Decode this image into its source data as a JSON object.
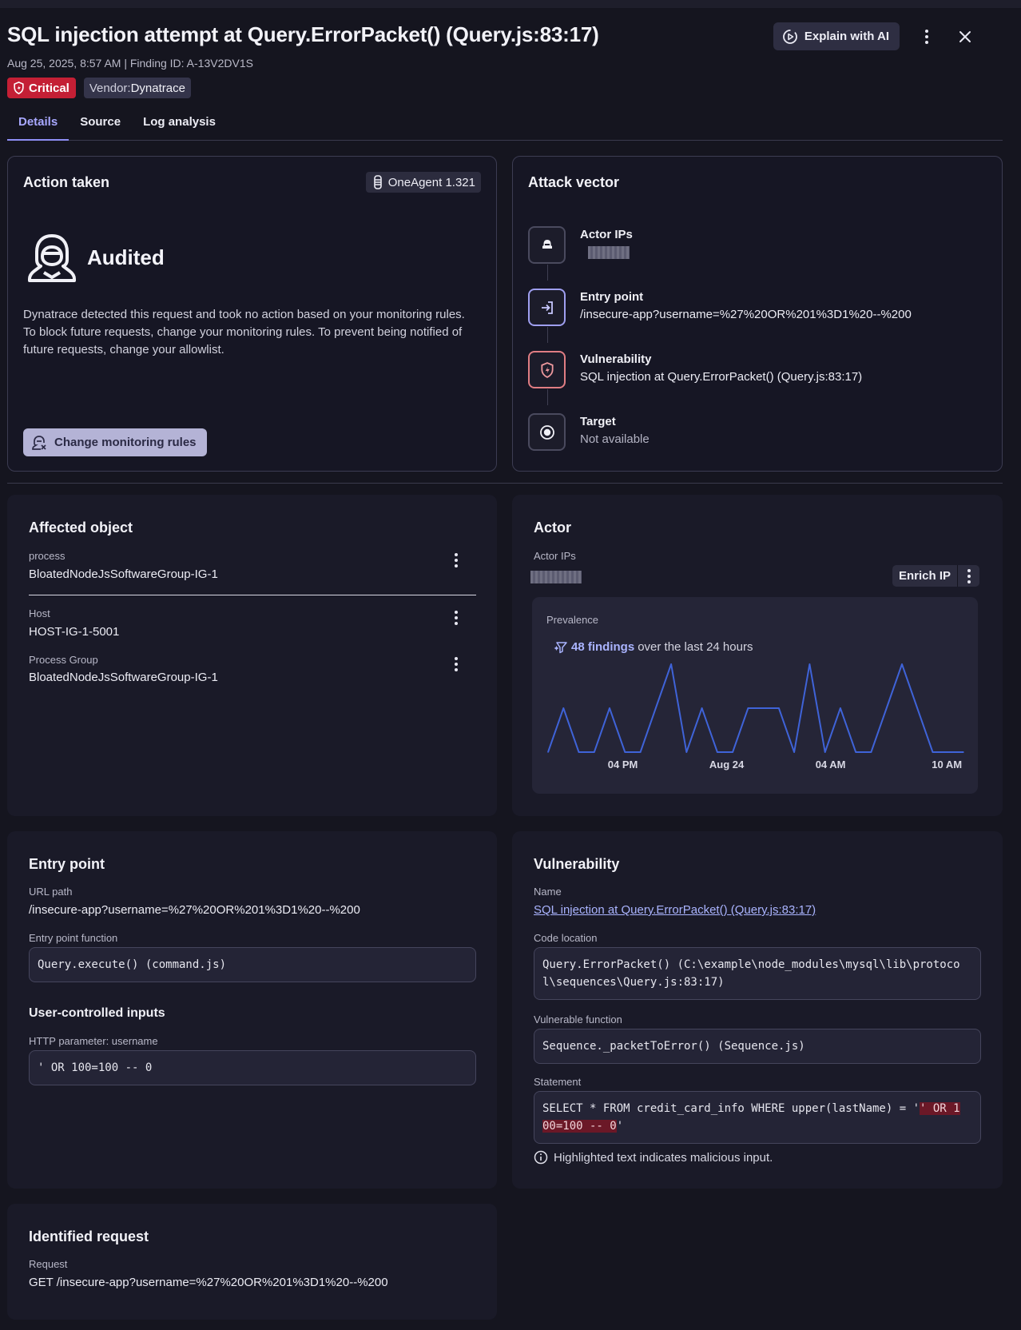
{
  "header": {
    "title": "SQL injection attempt at Query.ErrorPacket() (Query.js:83:17)",
    "meta": "Aug 25, 2025, 8:57 AM | Finding ID: A-13V2DV1S",
    "severity": "Critical",
    "vendor_label": "Vendor",
    "vendor_value": "Dynatrace",
    "explain_label": "Explain with AI"
  },
  "tabs": [
    "Details",
    "Source",
    "Log analysis"
  ],
  "action_taken": {
    "title": "Action taken",
    "agent": "OneAgent 1.321",
    "status": "Audited",
    "description": "Dynatrace detected this request and took no action based on your monitoring rules. To block future requests, change your monitoring rules. To prevent being notified of future requests, change your allowlist.",
    "button": "Change monitoring rules"
  },
  "attack_vector": {
    "title": "Attack vector",
    "items": [
      {
        "label": "Actor IPs",
        "value": ""
      },
      {
        "label": "Entry point",
        "value": "/insecure-app?username=%27%20OR%201%3D1%20--%200"
      },
      {
        "label": "Vulnerability",
        "value": "SQL injection at Query.ErrorPacket() (Query.js:83:17)"
      },
      {
        "label": "Target",
        "value": "Not available"
      }
    ]
  },
  "affected_object": {
    "title": "Affected object",
    "rows": [
      {
        "label": "process",
        "value": "BloatedNodeJsSoftwareGroup-IG-1"
      },
      {
        "label": "Host",
        "value": "HOST-IG-1-5001"
      },
      {
        "label": "Process Group",
        "value": "BloatedNodeJsSoftwareGroup-IG-1"
      }
    ]
  },
  "actor": {
    "title": "Actor",
    "ips_label": "Actor IPs",
    "enrich": "Enrich IP",
    "prevalence_label": "Prevalence",
    "findings_count": "48 findings",
    "findings_suffix": "over the last 24 hours"
  },
  "chart_data": {
    "type": "line",
    "x_ticks": [
      "04 PM",
      "Aug 24",
      "04 AM",
      "10 AM"
    ],
    "values": [
      0,
      1,
      0,
      0,
      1,
      0,
      0,
      1,
      2,
      0,
      1,
      0,
      0,
      1,
      1,
      1,
      0,
      2,
      0,
      1,
      0,
      0,
      1,
      2,
      1,
      0,
      0,
      0
    ],
    "series_color": "#3f63d8",
    "grid": false,
    "title": "",
    "xlabel": "",
    "ylabel": ""
  },
  "entry_point": {
    "title": "Entry point",
    "url_label": "URL path",
    "url": "/insecure-app?username=%27%20OR%201%3D1%20--%200",
    "func_label": "Entry point function",
    "func": "Query.execute() (command.js)",
    "inputs_title": "User-controlled inputs",
    "param_label": "HTTP parameter: username",
    "param_value": "' OR 100=100 -- 0"
  },
  "vulnerability": {
    "title": "Vulnerability",
    "name_label": "Name",
    "name": "SQL injection at Query.ErrorPacket() (Query.js:83:17)",
    "code_label": "Code location",
    "code_line1": "Query.ErrorPacket() (C:\\example\\node_modules\\mysql\\lib\\protoco",
    "code_line2": "l\\sequences\\Query.js:83:17)",
    "func_label": "Vulnerable function",
    "func": "Sequence._packetToError() (Sequence.js)",
    "statement_label": "Statement",
    "stmt_pre": "SELECT * FROM credit_card_info WHERE upper(lastName) = '",
    "stmt_hl1": "' OR 1",
    "stmt_hl2": "00=100 -- 0",
    "stmt_post": "'",
    "note": "Highlighted text indicates malicious input."
  },
  "identified_request": {
    "title": "Identified request",
    "label": "Request",
    "value": "GET /insecure-app?username=%27%20OR%201%3D1%20--%200"
  }
}
